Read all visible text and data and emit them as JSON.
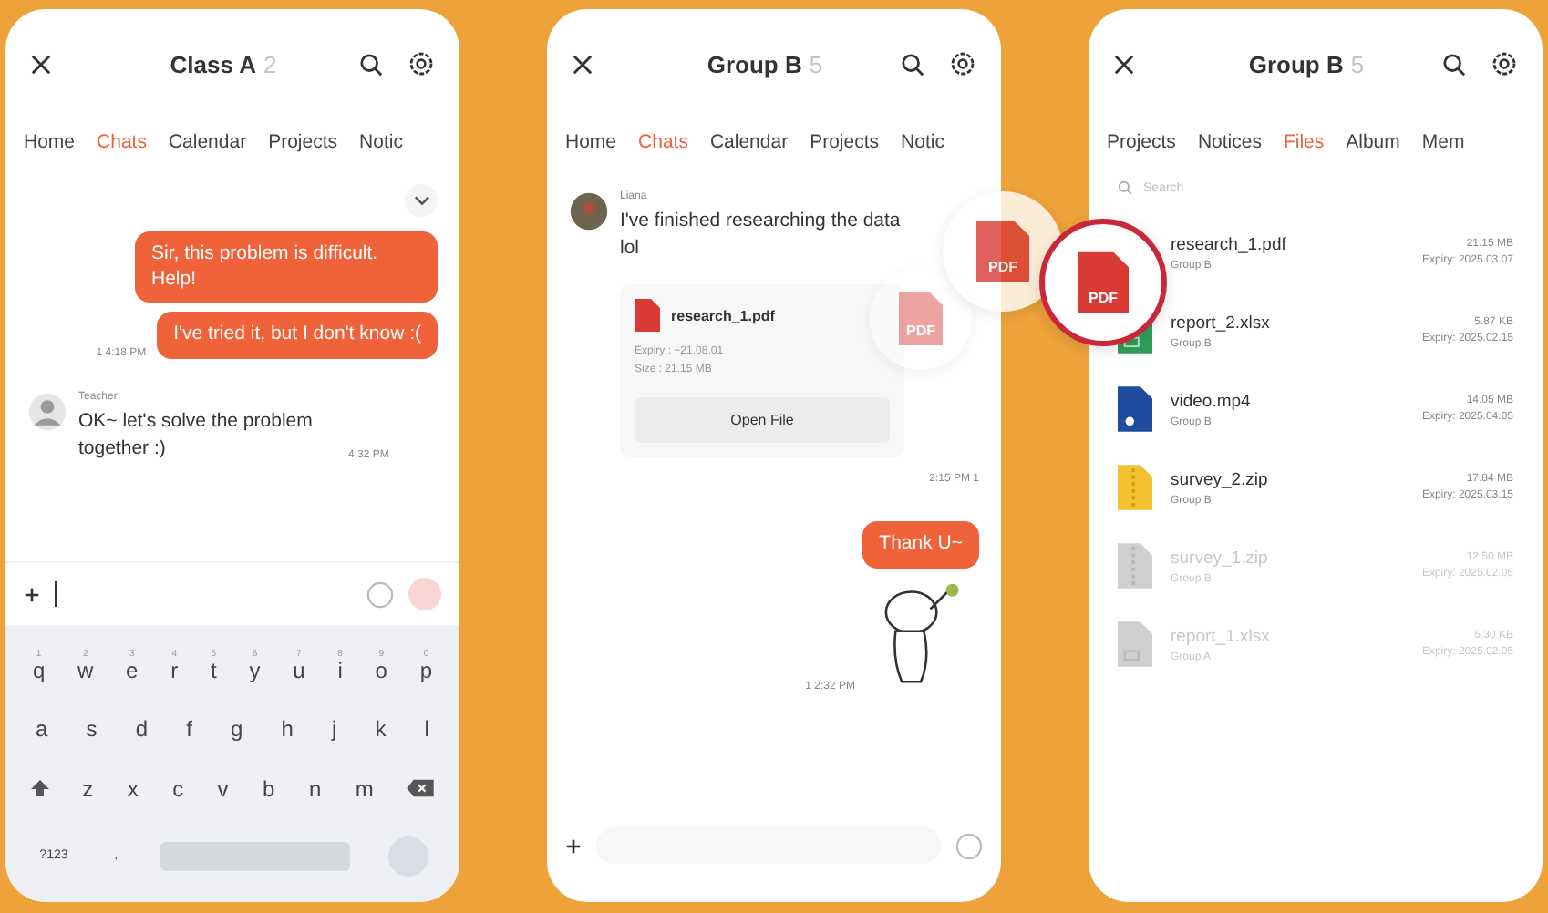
{
  "phone_1": {
    "header": {
      "title": "Class A",
      "count": "2"
    },
    "tabs": [
      {
        "label": "Home",
        "selected": false
      },
      {
        "label": "Chats",
        "selected": true
      },
      {
        "label": "Calendar",
        "selected": false
      },
      {
        "label": "Projects",
        "selected": false
      },
      {
        "label": "Notic",
        "selected": false
      }
    ],
    "sent": [
      {
        "text": "Sir, this problem is difficult. Help!"
      },
      {
        "text": "I've tried it, but I don't know :(",
        "time": "1 4:18 PM"
      }
    ],
    "reply": {
      "sender": "Teacher",
      "text": "OK~ let's solve the problem together :)",
      "time": "4:32 PM"
    },
    "keyboard": [
      [
        {
          "kind": "letter",
          "label": "q",
          "hint": "1"
        },
        {
          "kind": "letter",
          "label": "w",
          "hint": "2"
        },
        {
          "kind": "letter",
          "label": "e",
          "hint": "3"
        },
        {
          "kind": "letter",
          "label": "r",
          "hint": "4"
        },
        {
          "kind": "letter",
          "label": "t",
          "hint": "5"
        },
        {
          "kind": "letter",
          "label": "y",
          "hint": "6"
        },
        {
          "kind": "letter",
          "label": "u",
          "hint": "7"
        },
        {
          "kind": "letter",
          "label": "i",
          "hint": "8"
        },
        {
          "kind": "letter",
          "label": "o",
          "hint": "9"
        },
        {
          "kind": "letter",
          "label": "p",
          "hint": "0"
        }
      ],
      [
        {
          "kind": "letter",
          "label": "a"
        },
        {
          "kind": "letter",
          "label": "s"
        },
        {
          "kind": "letter",
          "label": "d"
        },
        {
          "kind": "letter",
          "label": "f"
        },
        {
          "kind": "letter",
          "label": "g"
        },
        {
          "kind": "letter",
          "label": "h"
        },
        {
          "kind": "letter",
          "label": "j"
        },
        {
          "kind": "letter",
          "label": "k"
        },
        {
          "kind": "letter",
          "label": "l"
        }
      ],
      [
        {
          "kind": "shift"
        },
        {
          "kind": "letter",
          "label": "z"
        },
        {
          "kind": "letter",
          "label": "x"
        },
        {
          "kind": "letter",
          "label": "c"
        },
        {
          "kind": "letter",
          "label": "v"
        },
        {
          "kind": "letter",
          "label": "b"
        },
        {
          "kind": "letter",
          "label": "n"
        },
        {
          "kind": "letter",
          "label": "m"
        },
        {
          "kind": "backspace"
        }
      ],
      [
        {
          "kind": "text",
          "label": "?123"
        },
        {
          "kind": "text",
          "label": ","
        },
        {
          "kind": "space"
        },
        {
          "kind": "enter"
        }
      ]
    ]
  },
  "phone_2": {
    "header": {
      "title": "Group B",
      "count": "5"
    },
    "tabs": [
      {
        "label": "Home",
        "selected": false
      },
      {
        "label": "Chats",
        "selected": true
      },
      {
        "label": "Calendar",
        "selected": false
      },
      {
        "label": "Projects",
        "selected": false
      },
      {
        "label": "Notic",
        "selected": false
      }
    ],
    "message": {
      "sender": "Liana",
      "text": "I've finished researching the data lol",
      "file": {
        "name": "research_1.pdf",
        "expiry": "Expiry : ~21.08.01",
        "size": "Size : 21.15 MB",
        "button": "Open File"
      },
      "time": "2:15 PM 1"
    },
    "sent": {
      "text": "Thank U~",
      "time": "1 2:32 PM"
    },
    "badges": [
      {
        "label": "PDF",
        "highlighted": false
      },
      {
        "label": "PDF",
        "highlighted": false
      },
      {
        "label": "PDF",
        "highlighted": true
      }
    ]
  },
  "phone_3": {
    "header": {
      "title": "Group B",
      "count": "5"
    },
    "tabs": [
      {
        "label": "Projects",
        "selected": false
      },
      {
        "label": "Notices",
        "selected": false
      },
      {
        "label": "Files",
        "selected": true
      },
      {
        "label": "Album",
        "selected": false
      },
      {
        "label": "Mem",
        "selected": false
      }
    ],
    "search": {
      "placeholder": "Search"
    },
    "files": [
      {
        "kind": "pdf",
        "name": "research_1.pdf",
        "group": "Group B",
        "size": "21.15 MB",
        "expiry": "Expiry: 2025.03.07",
        "expired": false
      },
      {
        "kind": "xlsx",
        "name": "report_2.xlsx",
        "group": "Group B",
        "size": "5.87 KB",
        "expiry": "Expiry: 2025.02.15",
        "expired": false
      },
      {
        "kind": "mp4",
        "name": "video.mp4",
        "group": "Group B",
        "size": "14.05 MB",
        "expiry": "Expiry: 2025.04.05",
        "expired": false
      },
      {
        "kind": "zip",
        "name": "survey_2.zip",
        "group": "Group B",
        "size": "17.84 MB",
        "expiry": "Expiry: 2025.03.15",
        "expired": false
      },
      {
        "kind": "zip",
        "name": "survey_1.zip",
        "group": "Group B",
        "size": "12.50 MB",
        "expiry": "Expiry: 2025.02.05",
        "expired": true
      },
      {
        "kind": "xlsx",
        "name": "report_1.xlsx",
        "group": "Group A",
        "size": "5.30 KB",
        "expiry": "Expiry: 2025.02.05",
        "expired": true
      }
    ]
  }
}
